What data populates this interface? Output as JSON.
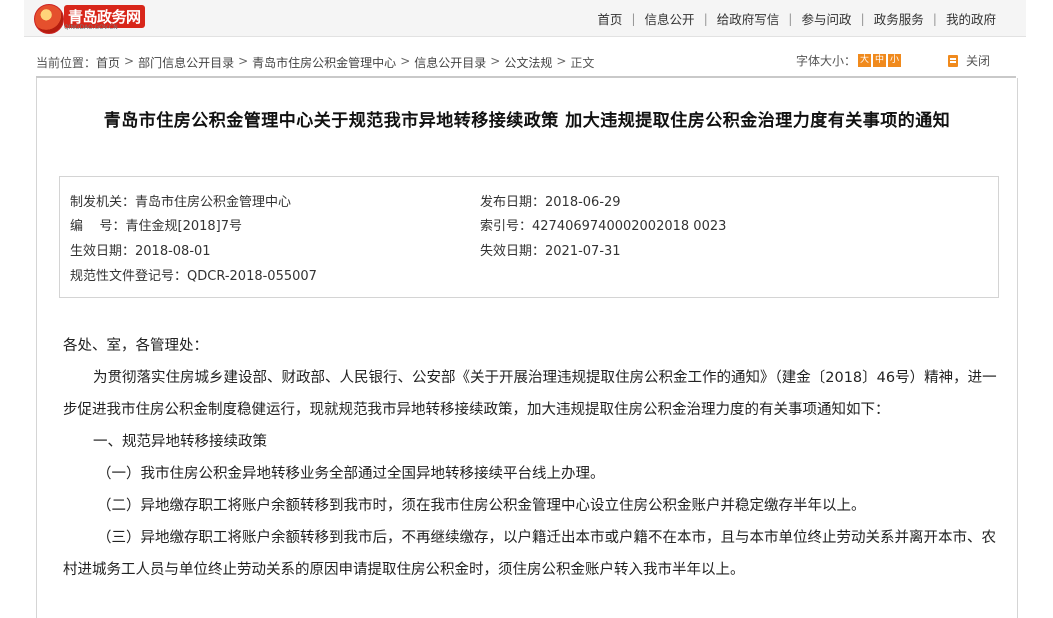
{
  "logo": {
    "text": "青岛政务网",
    "sub": "QINGDAO.GOV.CN"
  },
  "topnav": {
    "items": [
      "首页",
      "信息公开",
      "给政府写信",
      "参与问政",
      "政务服务",
      "我的政府"
    ]
  },
  "breadcrumb": {
    "prefix": "当前位置：",
    "items": [
      "首页",
      "部门信息公开目录",
      "青岛市住房公积金管理中心",
      "信息公开目录",
      "公文法规",
      "正文"
    ],
    "arrow": ">"
  },
  "fontsize": {
    "label": "字体大小：",
    "large": "大",
    "medium": "中",
    "small": "小"
  },
  "close_label": "关闭",
  "doc": {
    "title": "青岛市住房公积金管理中心关于规范我市异地转移接续政策 加大违规提取住房公积金治理力度有关事项的通知",
    "meta": {
      "issuer_label": "制发机关：",
      "issuer": "青岛市住房公积金管理中心",
      "publish_label": "发布日期：",
      "publish": "2018-06-29",
      "number_label": "编    号：",
      "number": "青住金规[2018]7号",
      "index_label": "索引号：",
      "index": "4274069740002002018 0023",
      "effective_label": "生效日期：",
      "effective": "2018-08-01",
      "expire_label": "失效日期：",
      "expire": "2021-07-31",
      "reg_label": "规范性文件登记号：",
      "reg": "QDCR-2018-055007"
    },
    "salutation": "各处、室，各管理处：",
    "para1": "为贯彻落实住房城乡建设部、财政部、人民银行、公安部《关于开展治理违规提取住房公积金工作的通知》（建金〔2018〕46号）精神，进一步促进我市住房公积金制度稳健运行，现就规范我市异地转移接续政策，加大违规提取住房公积金治理力度的有关事项通知如下：",
    "section1": "一、规范异地转移接续政策",
    "item1": "（一）我市住房公积金异地转移业务全部通过全国异地转移接续平台线上办理。",
    "item2": "（二）异地缴存职工将账户余额转移到我市时，须在我市住房公积金管理中心设立住房公积金账户并稳定缴存半年以上。",
    "item3": "（三）异地缴存职工将账户余额转移到我市后，不再继续缴存，以户籍迁出本市或户籍不在本市，且与本市单位终止劳动关系并离开本市、农村进城务工人员与单位终止劳动关系的原因申请提取住房公积金时，须住房公积金账户转入我市半年以上。"
  }
}
